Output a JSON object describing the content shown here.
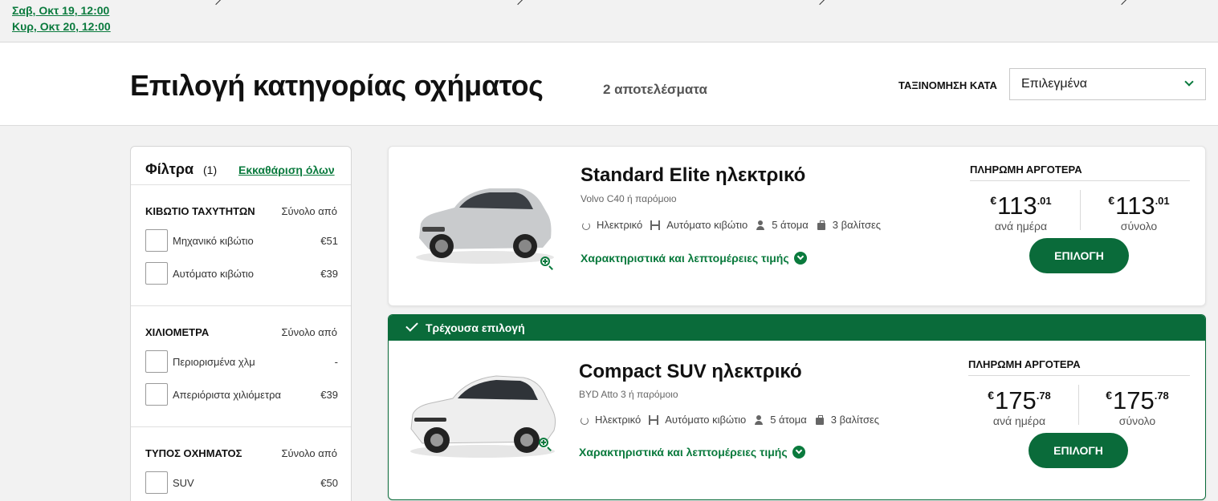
{
  "dates": {
    "pickup": "Σαβ, Οκτ 19, 12:00",
    "return": "Κυρ, Οκτ 20, 12:00"
  },
  "header": {
    "title": "Επιλογή κατηγορίας οχήματος",
    "result_count": "2 αποτελέσματα",
    "sort_label": "ΤΑΞΙΝΟΜΗΣΗ ΚΑΤΑ",
    "sort_value": "Επιλεγμένα"
  },
  "filters": {
    "title": "Φίλτρα",
    "count": "(1)",
    "clear_all": "Εκκαθάριση όλων",
    "groups": [
      {
        "heading": "ΚΙΒΩΤΙΟ ΤΑΧΥΤΗΤΩΝ",
        "from_label": "Σύνολο από",
        "options": [
          {
            "label": "Μηχανικό κιβώτιο",
            "price": "€51"
          },
          {
            "label": "Αυτόματο κιβώτιο",
            "price": "€39"
          }
        ]
      },
      {
        "heading": "ΧΙΛΙΟΜΕΤΡΑ",
        "from_label": "Σύνολο από",
        "options": [
          {
            "label": "Περιορισμένα χλμ",
            "price": "-"
          },
          {
            "label": "Απεριόριστα χιλιόμετρα",
            "price": "€39"
          }
        ]
      },
      {
        "heading": "ΤΥΠΟΣ ΟΧΗΜΑΤΟΣ",
        "from_label": "Σύνολο από",
        "options": [
          {
            "label": "SUV",
            "price": "€50"
          }
        ]
      }
    ]
  },
  "cars": [
    {
      "name": "Standard Elite ηλεκτρικό",
      "model": "Volvo C40 ή παρόμοιο",
      "features": {
        "fuel": "Ηλεκτρικό",
        "transmission": "Αυτόματο κιβώτιο",
        "seats": "5 άτομα",
        "bags": "3 βαλίτσες"
      },
      "details_link": "Χαρακτηριστικά και λεπτομέρειες τιμής",
      "pay_label": "ΠΛΗΡΩΜΗ ΑΡΓΟΤΕΡΑ",
      "currency": "€",
      "per_day_int": "113",
      "per_day_dec": ".01",
      "per_day_label": "ανά ημέρα",
      "total_int": "113",
      "total_dec": ".01",
      "total_label": "σύνολο",
      "select_label": "ΕΠΙΛΟΓΗ",
      "body_color": "#c9cbcd"
    },
    {
      "name": "Compact SUV ηλεκτρικό",
      "model": "BYD Atto 3 ή παρόμοιο",
      "features": {
        "fuel": "Ηλεκτρικό",
        "transmission": "Αυτόματο κιβώτιο",
        "seats": "5 άτομα",
        "bags": "3 βαλίτσες"
      },
      "details_link": "Χαρακτηριστικά και λεπτομέρειες τιμής",
      "pay_label": "ΠΛΗΡΩΜΗ ΑΡΓΟΤΕΡΑ",
      "currency": "€",
      "per_day_int": "175",
      "per_day_dec": ".78",
      "per_day_label": "ανά ημέρα",
      "total_int": "175",
      "total_dec": ".78",
      "total_label": "σύνολο",
      "select_label": "ΕΠΙΛΟΓΗ",
      "current_selection": "Τρέχουσα επιλογή",
      "body_color": "#eeeeee"
    }
  ],
  "colors": {
    "accent": "#0a7a3d",
    "button": "#0a6b3a",
    "page_bg": "#f2f2f2"
  }
}
